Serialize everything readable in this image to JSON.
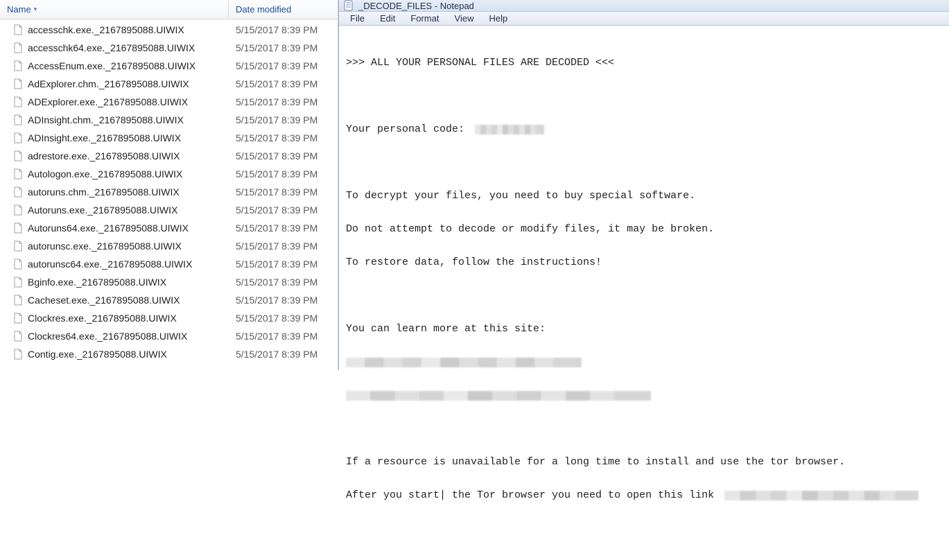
{
  "explorer": {
    "columns": {
      "name": "Name",
      "date": "Date modified"
    },
    "files": [
      {
        "name": "accesschk.exe._2167895088.UIWIX",
        "date": "5/15/2017 8:39 PM"
      },
      {
        "name": "accesschk64.exe._2167895088.UIWIX",
        "date": "5/15/2017 8:39 PM"
      },
      {
        "name": "AccessEnum.exe._2167895088.UIWIX",
        "date": "5/15/2017 8:39 PM"
      },
      {
        "name": "AdExplorer.chm._2167895088.UIWIX",
        "date": "5/15/2017 8:39 PM"
      },
      {
        "name": "ADExplorer.exe._2167895088.UIWIX",
        "date": "5/15/2017 8:39 PM"
      },
      {
        "name": "ADInsight.chm._2167895088.UIWIX",
        "date": "5/15/2017 8:39 PM"
      },
      {
        "name": "ADInsight.exe._2167895088.UIWIX",
        "date": "5/15/2017 8:39 PM"
      },
      {
        "name": "adrestore.exe._2167895088.UIWIX",
        "date": "5/15/2017 8:39 PM"
      },
      {
        "name": "Autologon.exe._2167895088.UIWIX",
        "date": "5/15/2017 8:39 PM"
      },
      {
        "name": "autoruns.chm._2167895088.UIWIX",
        "date": "5/15/2017 8:39 PM"
      },
      {
        "name": "Autoruns.exe._2167895088.UIWIX",
        "date": "5/15/2017 8:39 PM"
      },
      {
        "name": "Autoruns64.exe._2167895088.UIWIX",
        "date": "5/15/2017 8:39 PM"
      },
      {
        "name": "autorunsc.exe._2167895088.UIWIX",
        "date": "5/15/2017 8:39 PM"
      },
      {
        "name": "autorunsc64.exe._2167895088.UIWIX",
        "date": "5/15/2017 8:39 PM"
      },
      {
        "name": "Bginfo.exe._2167895088.UIWIX",
        "date": "5/15/2017 8:39 PM"
      },
      {
        "name": "Cacheset.exe._2167895088.UIWIX",
        "date": "5/15/2017 8:39 PM"
      },
      {
        "name": "Clockres.exe._2167895088.UIWIX",
        "date": "5/15/2017 8:39 PM"
      },
      {
        "name": "Clockres64.exe._2167895088.UIWIX",
        "date": "5/15/2017 8:39 PM"
      },
      {
        "name": "Contig.exe._2167895088.UIWIX",
        "date": "5/15/2017 8:39 PM"
      }
    ]
  },
  "notepad": {
    "title": "_DECODE_FILES - Notepad",
    "menus": [
      "File",
      "Edit",
      "Format",
      "View",
      "Help"
    ],
    "lines": {
      "l1": ">>> ALL YOUR PERSONAL FILES ARE DECODED <<<",
      "l2a": "Your personal code: ",
      "l3": "To decrypt your files, you need to buy special software.",
      "l4": "Do not attempt to decode or modify files, it may be broken.",
      "l5": "To restore data, follow the instructions!",
      "l6": "You can learn more at this site:",
      "l7": "If a resource is unavailable for a long time to install and use the tor browser.",
      "l8a": "After you start| the Tor browser you need to open this link "
    },
    "redactions": {
      "code_width": 100,
      "site1_width": 340,
      "site2_width": 440,
      "link_width": 280
    }
  }
}
